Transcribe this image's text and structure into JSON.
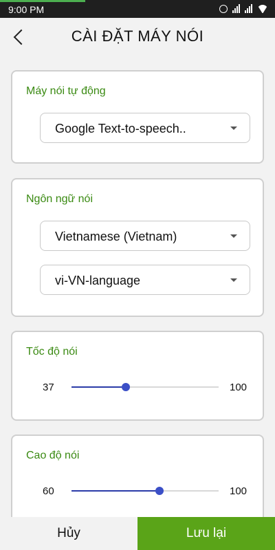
{
  "status_bar": {
    "time": "9:00 PM",
    "icons": [
      "alarm-icon",
      "cell-signal-icon",
      "cell-signal-icon",
      "wifi-icon"
    ],
    "download_progress": 0.31
  },
  "header": {
    "title": "CÀI ĐẶT MÁY NÓI",
    "back_icon": "chevron-left-icon"
  },
  "engine_card": {
    "label": "Máy nói tự động",
    "selected": "Google Text-to-speech.."
  },
  "language_card": {
    "label": "Ngôn ngữ nói",
    "language_selected": "Vietnamese (Vietnam)",
    "voice_selected": "vi-VN-language"
  },
  "speed_card": {
    "label": "Tốc độ nói",
    "value": "37",
    "max": "100",
    "fraction": 0.37
  },
  "pitch_card": {
    "label": "Cao độ nói",
    "value": "60",
    "max": "100",
    "fraction": 0.6
  },
  "footer": {
    "cancel_label": "Hủy",
    "save_label": "Lưu lại"
  },
  "colors": {
    "accent_green": "#5aa418",
    "label_green": "#3a8a12",
    "slider_blue": "#3b4fc7"
  }
}
